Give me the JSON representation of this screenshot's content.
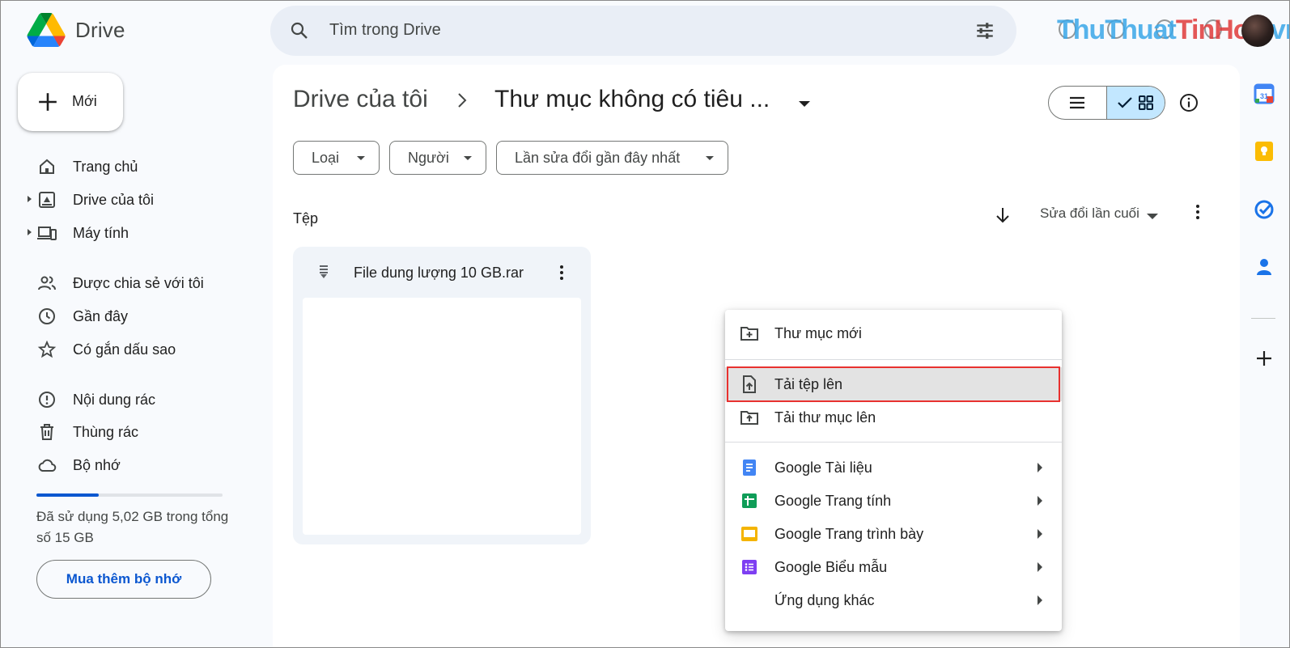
{
  "app": {
    "name": "Drive"
  },
  "header": {
    "search_placeholder": "Tìm trong Drive",
    "watermark_part1": "ThuThuat",
    "watermark_part2": "TinHoc",
    "watermark_part3": ".vn"
  },
  "sidebar": {
    "new_label": "Mới",
    "items": [
      {
        "label": "Trang chủ",
        "icon": "home-icon"
      },
      {
        "label": "Drive của tôi",
        "icon": "my-drive-icon"
      },
      {
        "label": "Máy tính",
        "icon": "computers-icon"
      },
      {
        "label": "Được chia sẻ với tôi",
        "icon": "shared-icon"
      },
      {
        "label": "Gần đây",
        "icon": "clock-icon"
      },
      {
        "label": "Có gắn dấu sao",
        "icon": "star-icon"
      },
      {
        "label": "Nội dung rác",
        "icon": "spam-icon"
      },
      {
        "label": "Thùng rác",
        "icon": "trash-icon"
      },
      {
        "label": "Bộ nhớ",
        "icon": "cloud-icon"
      }
    ],
    "storage": {
      "used_fraction": 0.335,
      "text": "Đã sử dụng 5,02 GB trong tổng số 15 GB",
      "buy_label": "Mua thêm bộ nhớ"
    }
  },
  "breadcrumb": {
    "root": "Drive của tôi",
    "current": "Thư mục không có tiêu ..."
  },
  "filters": {
    "type": "Loại",
    "people": "Người",
    "modified": "Lần sửa đổi gần đây nhất"
  },
  "files_section": {
    "title": "Tệp",
    "sort_label": "Sửa đổi lần cuối",
    "files": [
      {
        "name": "File dung lượng 10 GB.rar"
      }
    ]
  },
  "context_menu": {
    "new_folder": "Thư mục mới",
    "upload_file": "Tải tệp lên",
    "upload_folder": "Tải thư mục lên",
    "docs": "Google Tài liệu",
    "sheets": "Google Trang tính",
    "slides": "Google Trang trình bày",
    "forms": "Google Biểu mẫu",
    "more_apps": "Ứng dụng khác"
  },
  "colors": {
    "accent": "#0b57d0",
    "selected_view": "#c2e7ff",
    "highlight_border": "#e8312f",
    "docs": "#4285f4",
    "sheets": "#0f9d58",
    "slides": "#f4b400",
    "forms": "#7e3ff2"
  }
}
